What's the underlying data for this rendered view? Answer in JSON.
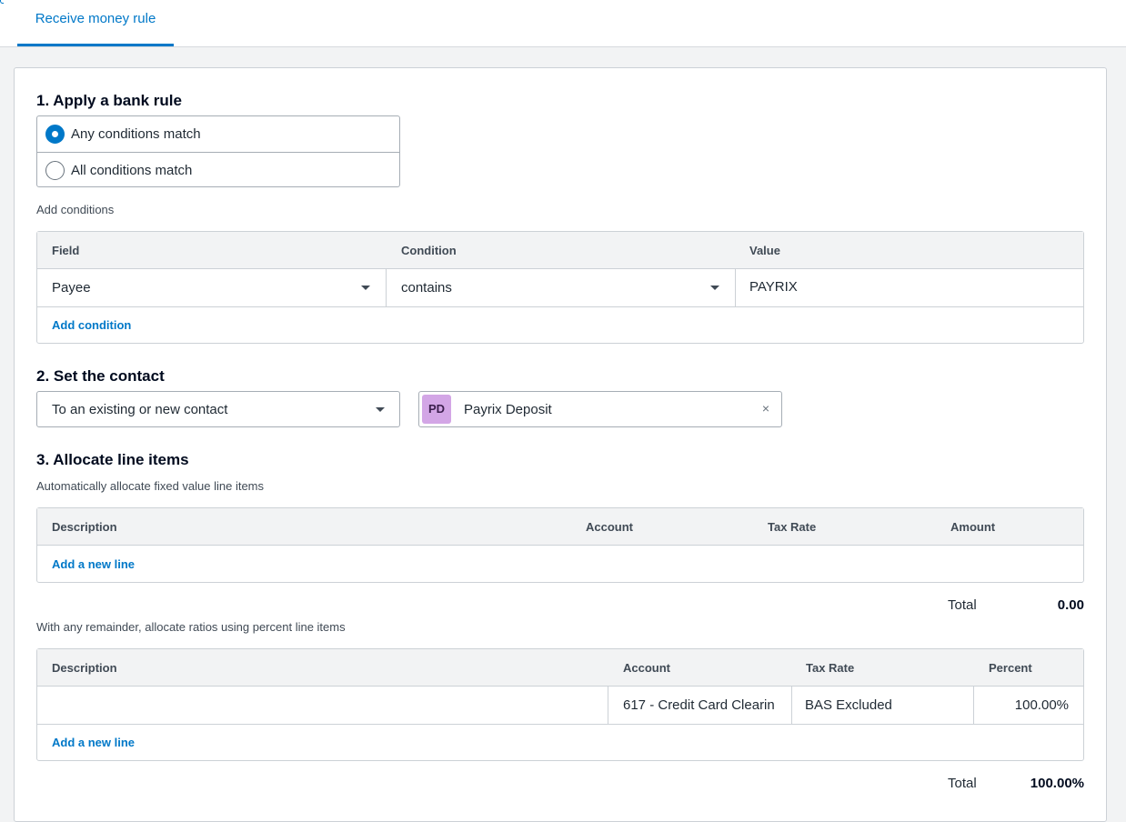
{
  "tab": {
    "label": "Receive money rule"
  },
  "section1": {
    "title": "1. Apply a bank rule",
    "radio": {
      "any": "Any conditions match",
      "all": "All conditions match",
      "selected": "any"
    },
    "add_conditions_label": "Add conditions",
    "table": {
      "headers": {
        "field": "Field",
        "condition": "Condition",
        "value": "Value"
      },
      "row": {
        "field": "Payee",
        "condition": "contains",
        "value": "PAYRIX"
      },
      "add_link": "Add condition"
    }
  },
  "section2": {
    "title": "2. Set the contact",
    "contact_type": "To an existing or new contact",
    "contact": {
      "initials": "PD",
      "name": "Payrix Deposit",
      "clear": "×"
    }
  },
  "section3": {
    "title": "3. Allocate line items",
    "fixed_label": "Automatically allocate fixed value line items",
    "fixed_table": {
      "headers": {
        "description": "Description",
        "account": "Account",
        "tax_rate": "Tax Rate",
        "amount": "Amount"
      },
      "add_link": "Add a new line"
    },
    "fixed_total": {
      "label": "Total",
      "value": "0.00"
    },
    "percent_label": "With any remainder, allocate ratios using percent line items",
    "percent_table": {
      "headers": {
        "description": "Description",
        "account": "Account",
        "tax_rate": "Tax Rate",
        "percent": "Percent"
      },
      "row": {
        "description": "",
        "account": "617 - Credit Card Clearin",
        "tax_rate": "BAS Excluded",
        "percent": "100.00%"
      },
      "add_link": "Add a new line"
    },
    "percent_total": {
      "label": "Total",
      "value": "100.00%"
    }
  },
  "colors": {
    "accent": "#0078c8",
    "avatar": "#d3a6e6"
  }
}
